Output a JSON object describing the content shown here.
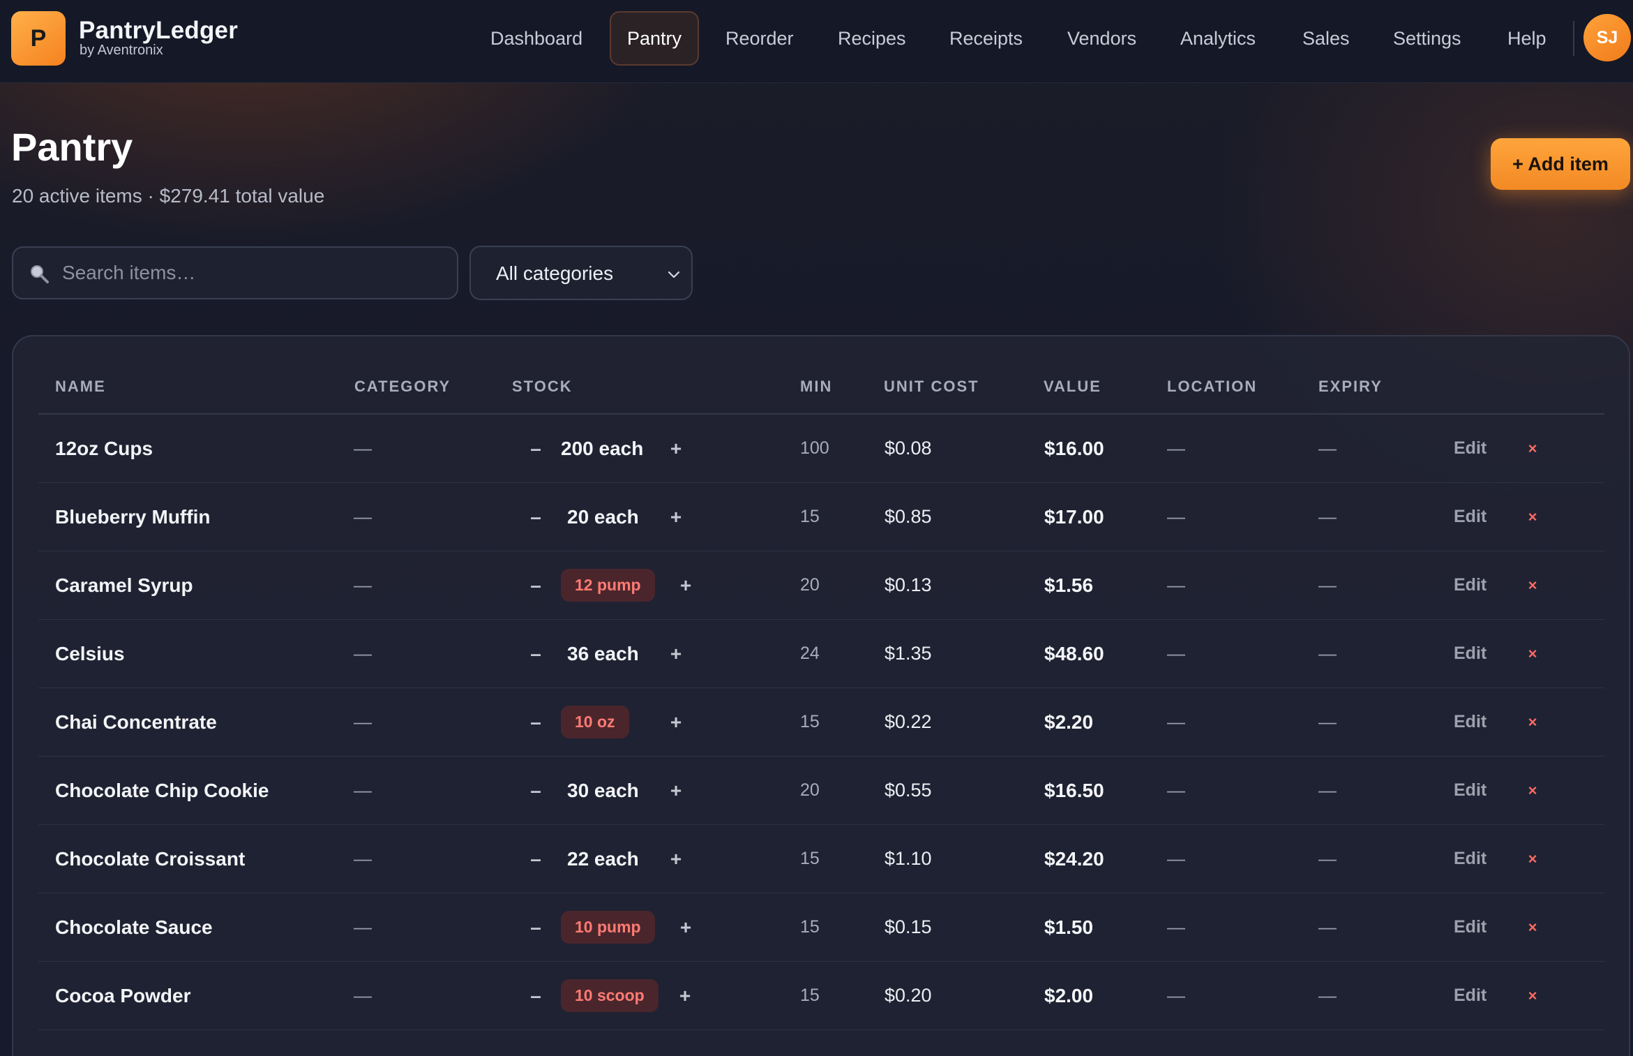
{
  "brand": {
    "logo_letter": "P",
    "name": "PantryLedger",
    "sub": "by Aventronix"
  },
  "nav": {
    "items": [
      "Dashboard",
      "Pantry",
      "Reorder",
      "Recipes",
      "Receipts",
      "Vendors",
      "Analytics",
      "Sales",
      "Settings",
      "Help"
    ],
    "active": "Pantry",
    "avatar_initials": "SJ"
  },
  "header": {
    "title": "Pantry",
    "subtitle": "20 active items · $279.41 total value",
    "add_button": "+ Add item"
  },
  "filters": {
    "search_placeholder": "Search items…",
    "category_value": "All categories"
  },
  "table": {
    "columns": [
      "NAME",
      "CATEGORY",
      "STOCK",
      "MIN",
      "UNIT COST",
      "VALUE",
      "LOCATION",
      "EXPIRY"
    ],
    "edit_label": "Edit",
    "delete_label": "×",
    "minus_label": "–",
    "plus_label": "+",
    "rows": [
      {
        "name": "12oz Cups",
        "category": "—",
        "stock": "200 each",
        "low": false,
        "min": "100",
        "unit_cost": "$0.08",
        "value": "$16.00",
        "location": "—",
        "expiry": "—"
      },
      {
        "name": "Blueberry Muffin",
        "category": "—",
        "stock": "20 each",
        "low": false,
        "min": "15",
        "unit_cost": "$0.85",
        "value": "$17.00",
        "location": "—",
        "expiry": "—"
      },
      {
        "name": "Caramel Syrup",
        "category": "—",
        "stock": "12 pump",
        "low": true,
        "min": "20",
        "unit_cost": "$0.13",
        "value": "$1.56",
        "location": "—",
        "expiry": "—"
      },
      {
        "name": "Celsius",
        "category": "—",
        "stock": "36 each",
        "low": false,
        "min": "24",
        "unit_cost": "$1.35",
        "value": "$48.60",
        "location": "—",
        "expiry": "—"
      },
      {
        "name": "Chai Concentrate",
        "category": "—",
        "stock": "10 oz",
        "low": true,
        "min": "15",
        "unit_cost": "$0.22",
        "value": "$2.20",
        "location": "—",
        "expiry": "—"
      },
      {
        "name": "Chocolate Chip Cookie",
        "category": "—",
        "stock": "30 each",
        "low": false,
        "min": "20",
        "unit_cost": "$0.55",
        "value": "$16.50",
        "location": "—",
        "expiry": "—"
      },
      {
        "name": "Chocolate Croissant",
        "category": "—",
        "stock": "22 each",
        "low": false,
        "min": "15",
        "unit_cost": "$1.10",
        "value": "$24.20",
        "location": "—",
        "expiry": "—"
      },
      {
        "name": "Chocolate Sauce",
        "category": "—",
        "stock": "10 pump",
        "low": true,
        "min": "15",
        "unit_cost": "$0.15",
        "value": "$1.50",
        "location": "—",
        "expiry": "—"
      },
      {
        "name": "Cocoa Powder",
        "category": "—",
        "stock": "10 scoop",
        "low": true,
        "min": "15",
        "unit_cost": "$0.20",
        "value": "$2.00",
        "location": "—",
        "expiry": "—"
      }
    ]
  },
  "colors": {
    "accent": "#f5921f",
    "low_stock_text": "#ff7b73",
    "low_stock_bg": "#4a262c",
    "delete": "#ff6a62"
  }
}
